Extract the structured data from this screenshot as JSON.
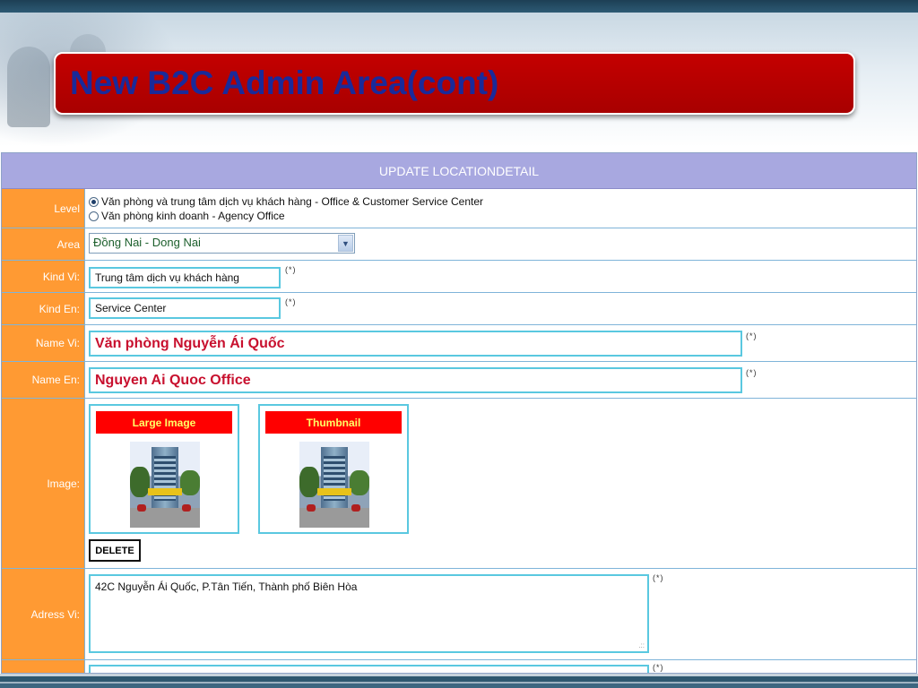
{
  "slide": {
    "title": "New B2C Admin Area(cont)"
  },
  "form": {
    "header": "UPDATE LOCATIONDETAIL",
    "required_mark": "(*)",
    "level": {
      "label": "Level",
      "options": [
        {
          "text": "Văn phòng và trung tâm dịch vụ khách hàng - Office & Customer Service Center",
          "selected": true
        },
        {
          "text": "Văn phòng kinh doanh - Agency Office",
          "selected": false
        }
      ]
    },
    "area": {
      "label": "Area",
      "value": "Đồng Nai - Dong Nai"
    },
    "kind_vi": {
      "label": "Kind Vi:",
      "value": "Trung tâm dịch vụ khách hàng"
    },
    "kind_en": {
      "label": "Kind En:",
      "value": "Service Center"
    },
    "name_vi": {
      "label": "Name Vi:",
      "value": "Văn phòng Nguyễn Ái Quốc"
    },
    "name_en": {
      "label": "Name En:",
      "value": "Nguyen Ai Quoc Office"
    },
    "image": {
      "label": "Image:",
      "large_title": "Large Image",
      "thumb_title": "Thumbnail",
      "delete_label": "DELETE"
    },
    "adress_vi": {
      "label": "Adress Vi:",
      "value": "42C Nguyễn Ái Quốc, P.Tân Tiến, Thành phố Biên Hòa"
    }
  },
  "colors": {
    "label_bg": "#ff9a33",
    "header_bg": "#a8a8e0",
    "title_box": "#c40000",
    "title_text": "#1a2a9a",
    "field_border": "#5ac8e0",
    "name_text": "#c8102e"
  }
}
